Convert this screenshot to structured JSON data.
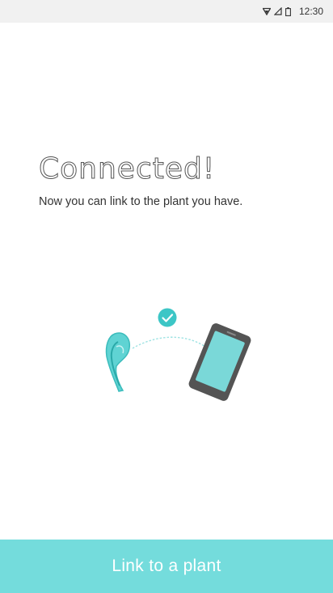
{
  "status_bar": {
    "time": "12:30",
    "icons": [
      "wifi-icon",
      "signal-icon",
      "battery-icon"
    ]
  },
  "main": {
    "title": "Connected!",
    "subtitle": "Now you can link to the plant you have."
  },
  "illustration": {
    "icons": [
      "plant-sensor-icon",
      "connection-arc",
      "check-badge-icon",
      "phone-icon"
    ]
  },
  "footer": {
    "button_label": "Link to a plant"
  },
  "colors": {
    "accent": "#74dcdc",
    "teal": "#3cc6c6",
    "phone_body": "#555555",
    "phone_screen": "#7ad8d8"
  }
}
